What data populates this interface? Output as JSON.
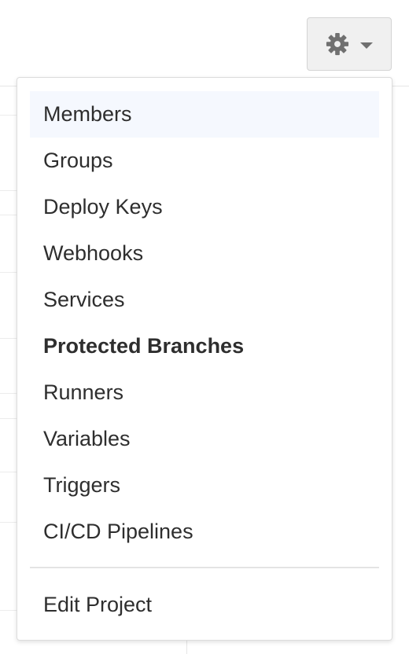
{
  "settings_button": {
    "icon": "gear-icon",
    "caret_icon": "caret-down-icon"
  },
  "menu": {
    "items": [
      {
        "label": "Members"
      },
      {
        "label": "Groups"
      },
      {
        "label": "Deploy Keys"
      },
      {
        "label": "Webhooks"
      },
      {
        "label": "Services"
      },
      {
        "label": "Protected Branches"
      },
      {
        "label": "Runners"
      },
      {
        "label": "Variables"
      },
      {
        "label": "Triggers"
      },
      {
        "label": "CI/CD Pipelines"
      }
    ],
    "footer_item": {
      "label": "Edit Project"
    }
  }
}
